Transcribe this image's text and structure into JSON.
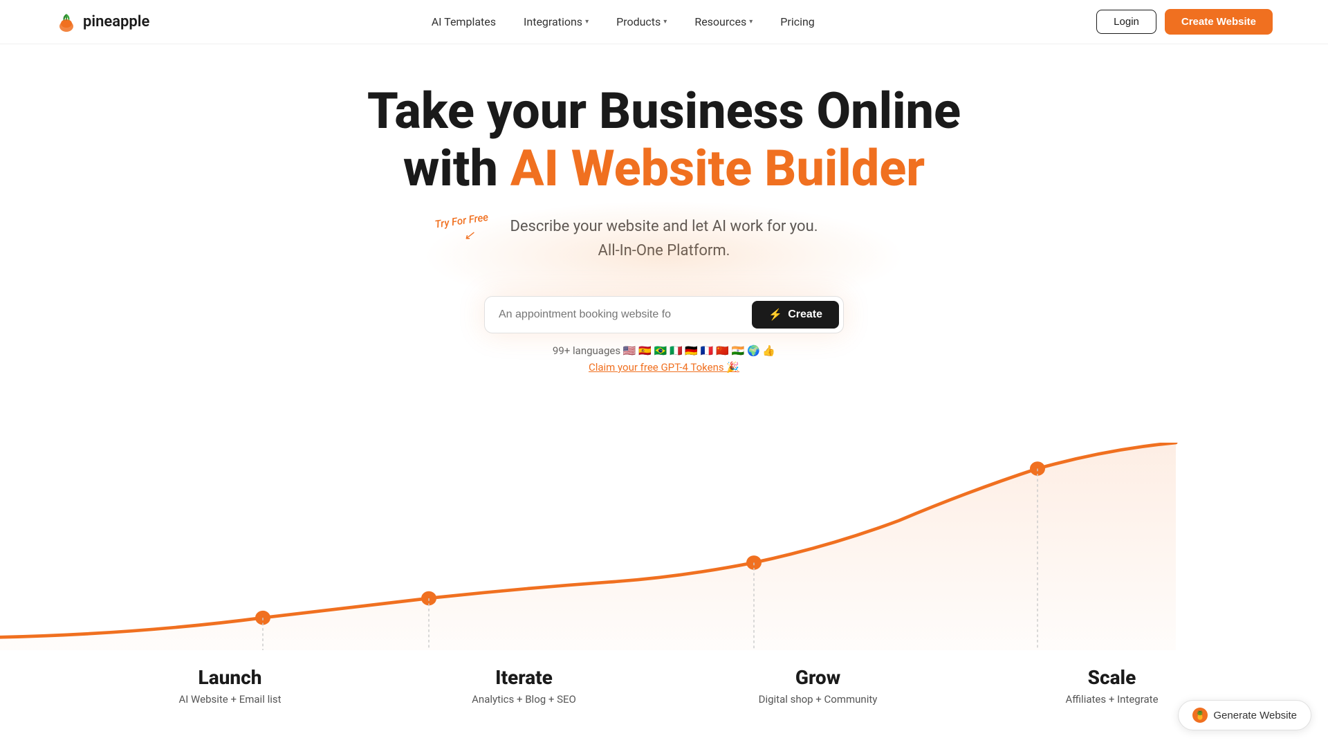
{
  "nav": {
    "logo_text": "pineapple",
    "links": [
      {
        "label": "AI Templates",
        "has_dropdown": false
      },
      {
        "label": "Integrations",
        "has_dropdown": true
      },
      {
        "label": "Products",
        "has_dropdown": true
      },
      {
        "label": "Resources",
        "has_dropdown": true
      },
      {
        "label": "Pricing",
        "has_dropdown": false
      }
    ],
    "login_label": "Login",
    "create_label": "Create Website"
  },
  "hero": {
    "title_line1": "Take your Business Online",
    "title_line2_prefix": "with ",
    "title_line2_accent": "AI Website Builder",
    "subtitle_line1": "Describe your website and let AI work for you.",
    "subtitle_line2": "All-In-One Platform.",
    "try_free": "Try For Free",
    "input_placeholder": "An appointment booking website fo",
    "create_btn": "Create",
    "languages_label": "99+ languages 🇺🇸 🇪🇸 🇧🇷 🇮🇹 🇩🇪 🇫🇷 🇨🇳 🇮🇳 🌍 👍",
    "claim_link": "Claim your free GPT-4 Tokens 🎉"
  },
  "chart": {
    "stages": [
      {
        "label": "Launch",
        "sublabel": "AI Website + Email list"
      },
      {
        "label": "Iterate",
        "sublabel": "Analytics + Blog + SEO"
      },
      {
        "label": "Grow",
        "sublabel": "Digital shop + Community"
      },
      {
        "label": "Scale",
        "sublabel": "Affiliates + Integrate"
      }
    ]
  },
  "generate_btn": "Generate Website"
}
